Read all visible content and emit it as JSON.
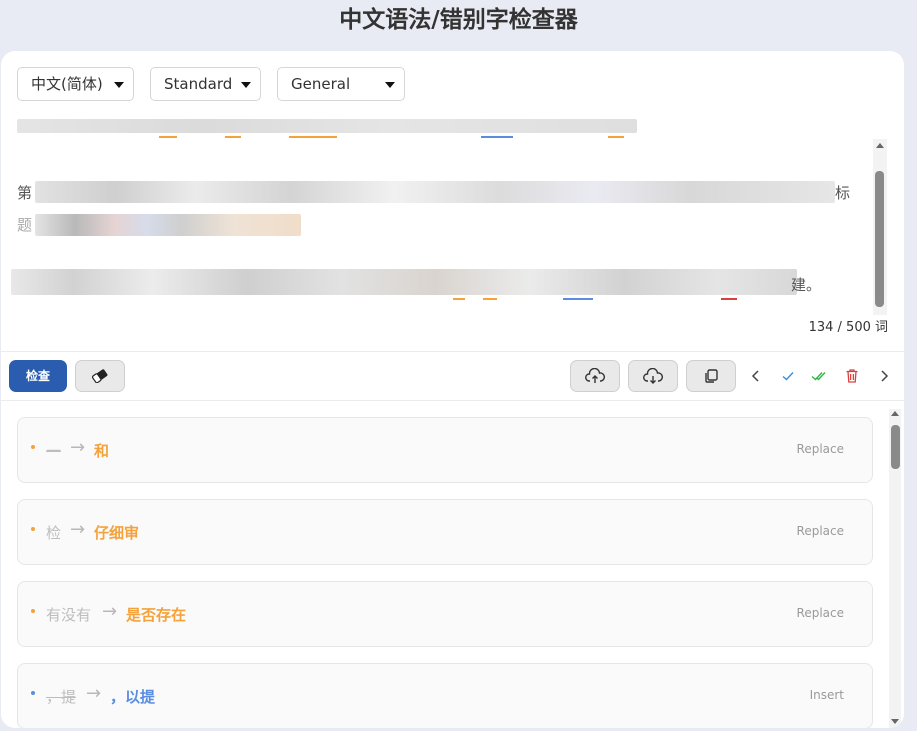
{
  "page_title": "中文语法/错别字检查器",
  "selects": {
    "language": "中文(简体)",
    "mode": "Standard",
    "domain": "General"
  },
  "editor": {
    "line2_start": "第",
    "line2_end": "标",
    "line3_start": "题",
    "line4_end": "建。"
  },
  "word_count": "134 / 500 词",
  "toolbar": {
    "check_label": "检查"
  },
  "icons": {
    "eraser": "eraser-icon",
    "upload": "cloud-upload-icon",
    "download": "cloud-download-icon",
    "copy": "copy-icon",
    "prev": "chevron-left-icon",
    "accept": "check-icon",
    "accept_all": "double-check-icon",
    "delete": "trash-icon",
    "next": "chevron-right-icon"
  },
  "colors": {
    "primary": "#2a5db0",
    "replace": "#f5a23b",
    "insert": "#5a8de0",
    "accept": "#3a8fd8",
    "accept_all": "#34b34a",
    "delete": "#d94040"
  },
  "suggestions": [
    {
      "original": "一",
      "replacement": "和",
      "action": "Replace",
      "kind": "replace"
    },
    {
      "original": "检",
      "replacement": "仔细审",
      "action": "Replace",
      "kind": "replace"
    },
    {
      "original": "有没有",
      "replacement": "是否存在",
      "action": "Replace",
      "kind": "replace"
    },
    {
      "original": "，提",
      "replacement": "，以提",
      "action": "Insert",
      "kind": "insert"
    }
  ]
}
